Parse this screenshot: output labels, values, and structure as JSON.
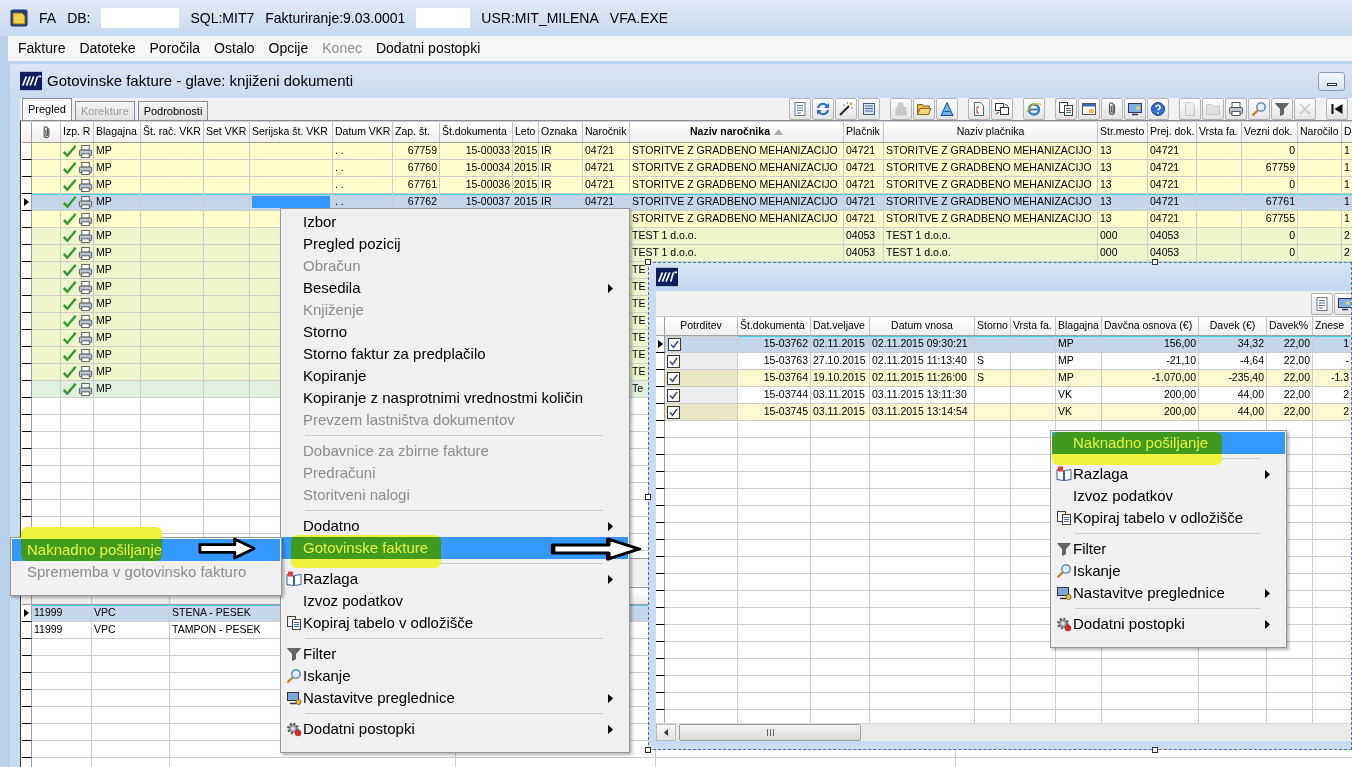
{
  "window": {
    "title_parts": [
      {
        "kind": "text",
        "text": "FA"
      },
      {
        "kind": "text",
        "text": "DB:"
      },
      {
        "kind": "redacted"
      },
      {
        "kind": "text",
        "text": "SQL:MIT7"
      },
      {
        "kind": "text",
        "text": "Fakturiranje:9.03.0001"
      },
      {
        "kind": "redacted"
      },
      {
        "kind": "text",
        "text": "USR:MIT_MILENA"
      },
      {
        "kind": "text",
        "text": "VFA.EXE"
      }
    ]
  },
  "menu_bar": [
    {
      "label": "Fakture",
      "disabled": false
    },
    {
      "label": "Datoteke",
      "disabled": false
    },
    {
      "label": "Poročila",
      "disabled": false
    },
    {
      "label": "Ostalo",
      "disabled": false
    },
    {
      "label": "Opcije",
      "disabled": false
    },
    {
      "label": "Konec",
      "disabled": true
    },
    {
      "label": "Dodatni postopki",
      "disabled": false
    }
  ],
  "document_window": {
    "title": "Gotovinske fakture - glave: knjiženi dokumenti",
    "tabs": [
      {
        "label": "Pregled",
        "selected": true,
        "disabled": false
      },
      {
        "label": "Korekture",
        "selected": false,
        "disabled": true
      },
      {
        "label": "Podrobnosti",
        "selected": false,
        "disabled": false
      }
    ],
    "toolbar": [
      [
        {
          "kind": "report",
          "disabled": false
        },
        {
          "kind": "refresh",
          "disabled": false
        },
        {
          "kind": "wand",
          "disabled": false
        },
        {
          "kind": "list",
          "disabled": false
        }
      ],
      [
        {
          "kind": "stamp",
          "disabled": true
        },
        {
          "kind": "open",
          "disabled": false
        },
        {
          "kind": "font",
          "disabled": false
        }
      ],
      [
        {
          "kind": "page",
          "disabled": false
        },
        {
          "kind": "transfer",
          "disabled": false
        }
      ],
      [
        {
          "kind": "browser",
          "disabled": false
        }
      ],
      [
        {
          "kind": "copy",
          "disabled": false
        },
        {
          "kind": "card",
          "disabled": false
        },
        {
          "kind": "attach",
          "disabled": false
        },
        {
          "kind": "screen",
          "disabled": false
        },
        {
          "kind": "help",
          "disabled": false
        }
      ],
      [
        {
          "kind": "new",
          "disabled": true
        },
        {
          "kind": "folder",
          "disabled": true
        },
        {
          "kind": "print",
          "disabled": false
        },
        {
          "kind": "search",
          "disabled": false
        },
        {
          "kind": "filter",
          "disabled": false
        },
        {
          "kind": "delete",
          "disabled": true
        }
      ],
      [
        {
          "kind": "first",
          "disabled": false
        }
      ]
    ],
    "table": {
      "columns": [
        {
          "label": "Izp. R",
          "sorted": false
        },
        {
          "label": "Blagajna",
          "sorted": false
        },
        {
          "label": "Št. rač. VKR",
          "sorted": false
        },
        {
          "label": "Set VKR",
          "sorted": false
        },
        {
          "label": "Serijska št. VKR",
          "sorted": false
        },
        {
          "label": "Datum VKR",
          "sorted": false
        },
        {
          "label": "Zap. št.",
          "sorted": false
        },
        {
          "label": "Št.dokumenta",
          "sorted": false
        },
        {
          "label": "Leto",
          "sorted": false
        },
        {
          "label": "Oznaka",
          "sorted": false
        },
        {
          "label": "Naročnik",
          "sorted": false
        },
        {
          "label": "Naziv naročnika",
          "sorted": true
        },
        {
          "label": "Plačnik",
          "sorted": false
        },
        {
          "label": "Naziv plačnika",
          "sorted": false
        },
        {
          "label": "Str.mesto",
          "sorted": false
        },
        {
          "label": "Prej. dok.",
          "sorted": false
        },
        {
          "label": "Vrsta fa.",
          "sorted": false
        },
        {
          "label": "Vezni dok.",
          "sorted": false
        },
        {
          "label": "Naročilo",
          "sorted": false
        },
        {
          "label": "D",
          "sorted": false
        }
      ],
      "rows": [
        {
          "selected": false,
          "color": "#ffffcc",
          "printed": true,
          "blagajna": "MP",
          "datum_vkr": ". .",
          "zap_st": "67759",
          "st_dokumenta": "15-00033",
          "leto": "2015",
          "oznaka": "IR",
          "narocnik": "04721",
          "naziv_narocnika": "STORITVE Z GRADBENO MEHANIZACIJO",
          "placnik": "04721",
          "naziv_placnika": "STORITVE Z GRADBENO MEHANIZACIJO",
          "str_mesto": "13",
          "prej_dok": "04721",
          "vezni_dok": "0",
          "column_d": "1"
        },
        {
          "selected": false,
          "color": "#ffffcc",
          "printed": true,
          "blagajna": "MP",
          "datum_vkr": ". .",
          "zap_st": "67760",
          "st_dokumenta": "15-00034",
          "leto": "2015",
          "oznaka": "IR",
          "narocnik": "04721",
          "naziv_narocnika": "STORITVE Z GRADBENO MEHANIZACIJO",
          "placnik": "04721",
          "naziv_placnika": "STORITVE Z GRADBENO MEHANIZACIJO",
          "str_mesto": "13",
          "prej_dok": "04721",
          "vezni_dok": "67759",
          "column_d": "1"
        },
        {
          "selected": false,
          "color": "#ffffcc",
          "printed": true,
          "blagajna": "MP",
          "datum_vkr": ". .",
          "zap_st": "67761",
          "st_dokumenta": "15-00036",
          "leto": "2015",
          "oznaka": "IR",
          "narocnik": "04721",
          "naziv_narocnika": "STORITVE Z GRADBENO MEHANIZACIJO",
          "placnik": "04721",
          "naziv_placnika": "STORITVE Z GRADBENO MEHANIZACIJO",
          "str_mesto": "13",
          "prej_dok": "04721",
          "vezni_dok": "0",
          "column_d": "1"
        },
        {
          "selected": true,
          "printed": true,
          "blagajna": "MP",
          "datum_vkr": ". .",
          "zap_st": "67762",
          "st_dokumenta": "15-00037",
          "leto": "2015",
          "oznaka": "IR",
          "narocnik": "04721",
          "naziv_narocnika": "STORITVE Z GRADBENO MEHANIZACIJO",
          "placnik": "04721",
          "naziv_placnika": "STORITVE Z GRADBENO MEHANIZACIJO",
          "str_mesto": "13",
          "prej_dok": "04721",
          "vezni_dok": "67761",
          "column_d": "1"
        },
        {
          "selected": false,
          "color": "#ffffcc",
          "printed": true,
          "blagajna": "MP",
          "naziv_narocnika": "STORITVE Z GRADBENO MEHANIZACIJO",
          "placnik": "04721",
          "naziv_placnika": "STORITVE Z GRADBENO MEHANIZACIJO",
          "str_mesto": "13",
          "prej_dok": "04721",
          "vezni_dok": "67755",
          "column_d": "1"
        },
        {
          "selected": false,
          "color": "#eef5cc",
          "printed": true,
          "blagajna": "MP",
          "naziv_narocnika": "TEST 1 d.o.o.",
          "placnik": "04053",
          "naziv_placnika": "TEST 1 d.o.o.",
          "str_mesto": "000",
          "prej_dok": "04053",
          "vezni_dok": "0",
          "column_d": "2"
        },
        {
          "selected": false,
          "color": "#eef5cc",
          "printed": true,
          "blagajna": "MP",
          "naziv_narocnika": "TEST 1 d.o.o.",
          "placnik": "04053",
          "naziv_placnika": "TEST 1 d.o.o.",
          "str_mesto": "000",
          "prej_dok": "04053",
          "vezni_dok": "0",
          "column_d": "2"
        },
        {
          "selected": false,
          "color": "#eef5cc",
          "printed": true,
          "blagajna": "MP",
          "naziv_narocnika": "TE"
        },
        {
          "selected": false,
          "color": "#eef5cc",
          "printed": true,
          "blagajna": "MP",
          "naziv_narocnika": "TE"
        },
        {
          "selected": false,
          "color": "#eef5cc",
          "printed": true,
          "blagajna": "MP",
          "naziv_narocnika": "TE"
        },
        {
          "selected": false,
          "color": "#eef5cc",
          "printed": true,
          "blagajna": "MP",
          "naziv_narocnika": "TE"
        },
        {
          "selected": false,
          "color": "#eef5cc",
          "printed": true,
          "blagajna": "MP",
          "naziv_narocnika": "TE"
        },
        {
          "selected": false,
          "color": "#eef5cc",
          "printed": true,
          "blagajna": "MP",
          "naziv_narocnika": "TE"
        },
        {
          "selected": false,
          "color": "#eef5cc",
          "printed": true,
          "blagajna": "MP",
          "naziv_narocnika": "TE"
        },
        {
          "selected": false,
          "color": "#e1f0dc",
          "printed": true,
          "blagajna": "MP",
          "naziv_narocnika": "Te"
        }
      ]
    },
    "detail_table": {
      "rows": [
        {
          "selected": true,
          "cells": [
            "11999",
            "VPC",
            "STENA - PESEK"
          ]
        },
        {
          "selected": false,
          "cells": [
            "11999",
            "VPC",
            "TAMPON - PESEK"
          ]
        }
      ]
    }
  },
  "context_menu": {
    "items": [
      {
        "kind": "text",
        "label": "Izbor",
        "disabled": false,
        "selected": false,
        "submenu": false
      },
      {
        "kind": "text",
        "label": "Pregled pozicij",
        "disabled": false,
        "selected": false,
        "submenu": false
      },
      {
        "kind": "text",
        "label": "Obračun",
        "disabled": true,
        "selected": false,
        "submenu": false
      },
      {
        "kind": "text",
        "label": "Besedila",
        "disabled": false,
        "selected": false,
        "submenu": true
      },
      {
        "kind": "text",
        "label": "Knjiženje",
        "disabled": true,
        "selected": false,
        "submenu": false
      },
      {
        "kind": "text",
        "label": "Storno",
        "disabled": false,
        "selected": false,
        "submenu": false
      },
      {
        "kind": "text",
        "label": "Storno faktur za predplačilo",
        "disabled": false,
        "selected": false,
        "submenu": false
      },
      {
        "kind": "text",
        "label": "Kopiranje",
        "disabled": false,
        "selected": false,
        "submenu": false
      },
      {
        "kind": "text",
        "label": "Kopiranje z nasprotnimi vrednostmi količin",
        "disabled": false,
        "selected": false,
        "submenu": false
      },
      {
        "kind": "text",
        "label": "Prevzem lastništva dokumentov",
        "disabled": true,
        "selected": false,
        "submenu": false
      },
      {
        "kind": "separator"
      },
      {
        "kind": "text",
        "label": "Dobavnice za zbirne fakture",
        "disabled": true,
        "selected": false,
        "submenu": false
      },
      {
        "kind": "text",
        "label": "Predračuni",
        "disabled": true,
        "selected": false,
        "submenu": false
      },
      {
        "kind": "text",
        "label": "Storitveni nalogi",
        "disabled": true,
        "selected": false,
        "submenu": false
      },
      {
        "kind": "separator"
      },
      {
        "kind": "text",
        "label": "Dodatno",
        "disabled": false,
        "selected": false,
        "submenu": true
      },
      {
        "kind": "text",
        "label": "Gotovinske fakture",
        "disabled": false,
        "selected": true,
        "submenu": false
      },
      {
        "kind": "separator"
      },
      {
        "kind": "explain",
        "label": "Razlaga",
        "disabled": false,
        "selected": false,
        "submenu": true
      },
      {
        "kind": "text",
        "label": "Izvoz podatkov",
        "disabled": false,
        "selected": false,
        "submenu": false
      },
      {
        "kind": "copy",
        "label": "Kopiraj tabelo v odložišče",
        "disabled": false,
        "selected": false,
        "submenu": false
      },
      {
        "kind": "separator"
      },
      {
        "kind": "filter",
        "label": "Filter",
        "disabled": false,
        "selected": false,
        "submenu": false
      },
      {
        "kind": "search",
        "label": "Iskanje",
        "disabled": false,
        "selected": false,
        "submenu": false
      },
      {
        "kind": "settings",
        "label": "Nastavitve preglednice",
        "disabled": false,
        "selected": false,
        "submenu": true
      },
      {
        "kind": "separator"
      },
      {
        "kind": "tools",
        "label": "Dodatni postopki",
        "disabled": false,
        "selected": false,
        "submenu": true
      }
    ]
  },
  "submenu": {
    "items": [
      {
        "label": "Naknadno pošiljanje",
        "disabled": false,
        "selected": true,
        "submenu": false
      },
      {
        "label": "Sprememba v gotovinsko fakturo",
        "disabled": true,
        "selected": false,
        "submenu": false
      }
    ]
  },
  "popup_window": {
    "toolbar": [
      [
        {
          "kind": "report",
          "disabled": false
        },
        {
          "kind": "screen",
          "disabled": false
        }
      ]
    ],
    "table": {
      "columns": [
        {
          "label": "Potrditev"
        },
        {
          "label": "Št.dokumenta"
        },
        {
          "label": "Dat.veljave"
        },
        {
          "label": "Datum vnosa"
        },
        {
          "label": "Storno"
        },
        {
          "label": "Vrsta fa."
        },
        {
          "label": "Blagajna"
        },
        {
          "label": "Davčna osnova (€)"
        },
        {
          "label": "Davek (€)"
        },
        {
          "label": "Davek%"
        },
        {
          "label": "Znese"
        }
      ],
      "rows": [
        {
          "selected": true,
          "confirmed": true,
          "st_dokumenta": "15-03762",
          "dat_veljave": "02.11.2015",
          "datum_vnosa": "02.11.2015 09:30:21",
          "blagajna": "MP",
          "davcna_osnova": "156,00",
          "davek": "34,32",
          "davek_pct": "22,00",
          "znese": "1"
        },
        {
          "selected": false,
          "color": "#ffffff",
          "confirmed": true,
          "st_dokumenta": "15-03763",
          "dat_veljave": "27.10.2015",
          "datum_vnosa": "02.11.2015 11:13:40",
          "storno": "S",
          "blagajna": "MP",
          "davcna_osnova": "-21,10",
          "davek": "-4,64",
          "davek_pct": "22,00",
          "znese": "-"
        },
        {
          "selected": false,
          "color": "#fbf8d2",
          "confirmed": true,
          "st_dokumenta": "15-03764",
          "dat_veljave": "19.10.2015",
          "datum_vnosa": "02.11.2015 11:26:00",
          "storno": "S",
          "blagajna": "MP",
          "davcna_osnova": "-1.070,00",
          "davek": "-235,40",
          "davek_pct": "22,00",
          "znese": "-1.3"
        },
        {
          "selected": false,
          "color": "#ffffff",
          "confirmed": true,
          "st_dokumenta": "15-03744",
          "dat_veljave": "03.11.2015",
          "datum_vnosa": "03.11.2015 13:11:30",
          "blagajna": "VK",
          "davcna_osnova": "200,00",
          "davek": "44,00",
          "davek_pct": "22,00",
          "znese": "2"
        },
        {
          "selected": false,
          "color": "#fbf8d2",
          "confirmed": true,
          "st_dokumenta": "15-03745",
          "dat_veljave": "03.11.2015",
          "datum_vnosa": "03.11.2015 13:14:54",
          "blagajna": "VK",
          "davcna_osnova": "200,00",
          "davek": "44,00",
          "davek_pct": "22,00",
          "znese": "2"
        }
      ]
    },
    "context_menu": {
      "items": [
        {
          "kind": "text",
          "label": "Naknadno pošiljanje",
          "disabled": false,
          "selected": true,
          "submenu": false
        },
        {
          "kind": "separator"
        },
        {
          "kind": "explain",
          "label": "Razlaga",
          "disabled": false,
          "selected": false,
          "submenu": true
        },
        {
          "kind": "text",
          "label": "Izvoz podatkov",
          "disabled": false,
          "selected": false,
          "submenu": false
        },
        {
          "kind": "copy",
          "label": "Kopiraj tabelo v odložišče",
          "disabled": false,
          "selected": false,
          "submenu": false
        },
        {
          "kind": "separator"
        },
        {
          "kind": "filter",
          "label": "Filter",
          "disabled": false,
          "selected": false,
          "submenu": false
        },
        {
          "kind": "search",
          "label": "Iskanje",
          "disabled": false,
          "selected": false,
          "submenu": false
        },
        {
          "kind": "settings",
          "label": "Nastavitve preglednice",
          "disabled": false,
          "selected": false,
          "submenu": true
        },
        {
          "kind": "separator"
        },
        {
          "kind": "tools",
          "label": "Dodatni postopki",
          "disabled": false,
          "selected": false,
          "submenu": true
        }
      ]
    }
  }
}
